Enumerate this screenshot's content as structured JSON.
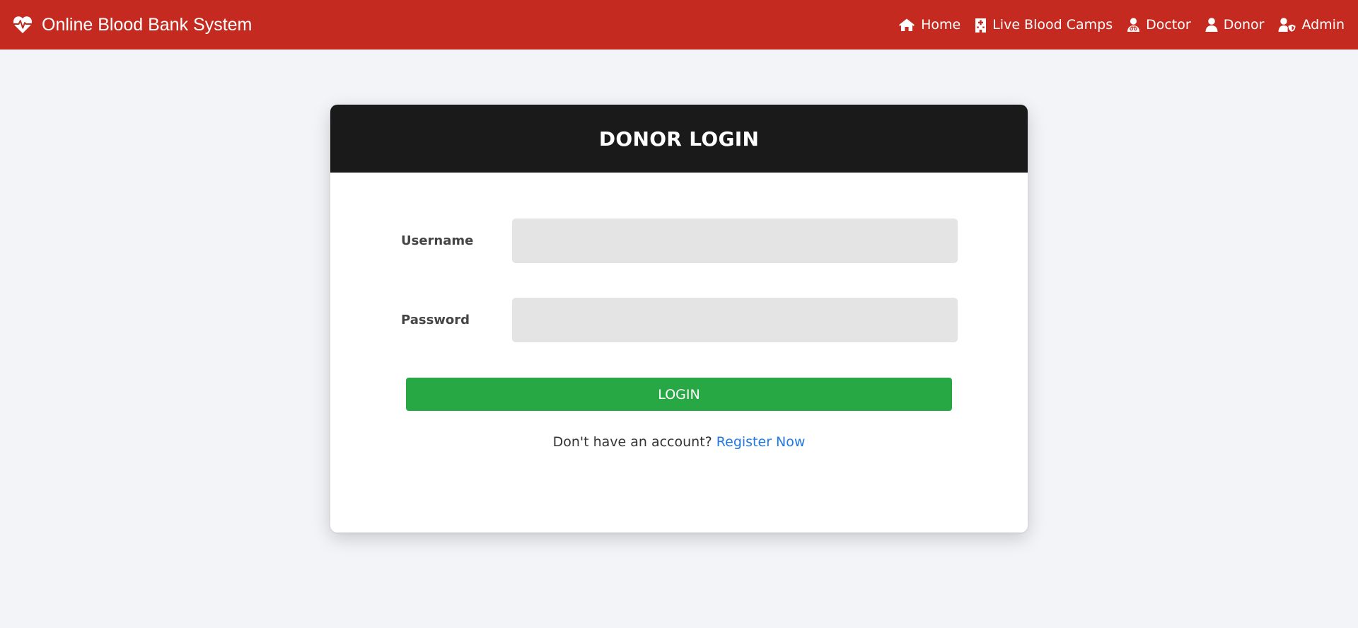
{
  "navbar": {
    "brand": "Online Blood Bank System",
    "brand_icon": "heartbeat-icon",
    "bg_color": "#c52a21",
    "links": [
      {
        "label": "Home",
        "icon": "home-icon"
      },
      {
        "label": "Live Blood Camps",
        "icon": "hospital-icon"
      },
      {
        "label": "Doctor",
        "icon": "doctor-icon"
      },
      {
        "label": "Donor",
        "icon": "user-icon"
      },
      {
        "label": "Admin",
        "icon": "user-shield-icon"
      }
    ]
  },
  "login": {
    "title": "DONOR LOGIN",
    "username_label": "Username",
    "username_value": "",
    "password_label": "Password",
    "password_value": "",
    "button_label": "LOGIN",
    "button_color": "#28a745",
    "signup_prompt": "Don't have an account?",
    "register_label": "Register Now",
    "link_color": "#1f78e6"
  }
}
